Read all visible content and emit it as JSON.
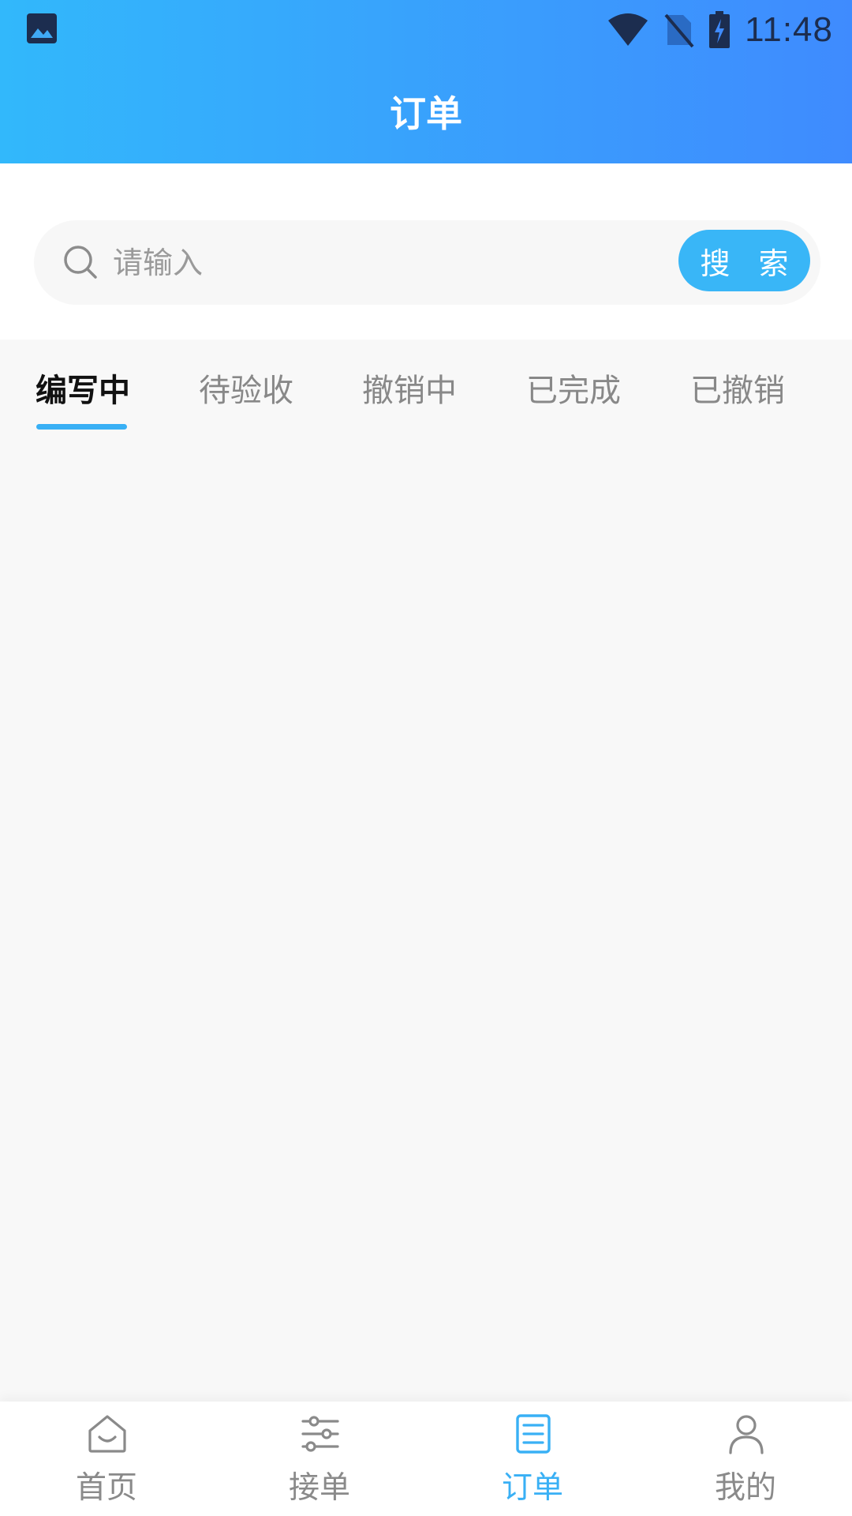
{
  "status_bar": {
    "time": "11:48"
  },
  "header": {
    "title": "订单"
  },
  "search": {
    "placeholder": "请输入",
    "button_label": "搜 索"
  },
  "tabs": [
    {
      "label": "编写中",
      "active": true
    },
    {
      "label": "待验收",
      "active": false
    },
    {
      "label": "撤销中",
      "active": false
    },
    {
      "label": "已完成",
      "active": false
    },
    {
      "label": "已撤销",
      "active": false
    }
  ],
  "bottom_nav": [
    {
      "label": "首页",
      "icon": "home-icon",
      "active": false
    },
    {
      "label": "接单",
      "icon": "sliders-icon",
      "active": false
    },
    {
      "label": "订单",
      "icon": "order-list-icon",
      "active": true
    },
    {
      "label": "我的",
      "icon": "profile-icon",
      "active": false
    }
  ],
  "colors": {
    "header_gradient_start": "#32b8fb",
    "header_gradient_end": "#3f8bfe",
    "accent": "#39b0f5",
    "inactive_text": "#888888"
  }
}
